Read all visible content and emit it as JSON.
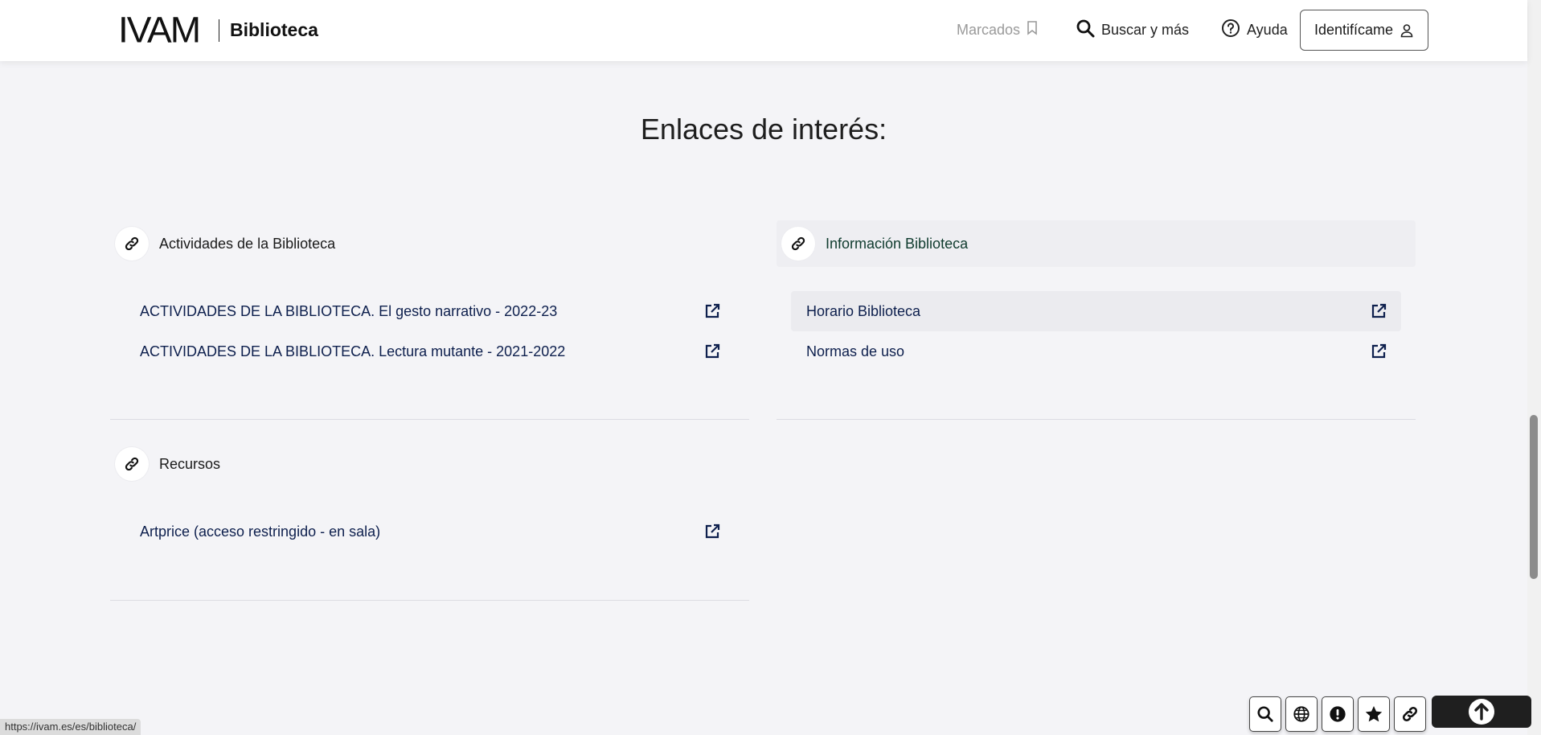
{
  "header": {
    "logo": "IVAM",
    "site_name": "Biblioteca",
    "marcados": "Marcados",
    "buscar": "Buscar y más",
    "ayuda": "Ayuda",
    "login": "Identifícame"
  },
  "main": {
    "title": "Enlaces de interés:",
    "cards": [
      {
        "title": "Actividades de la Biblioteca",
        "links": [
          "ACTIVIDADES DE LA BIBLIOTECA. El gesto narrativo - 2022-23",
          "ACTIVIDADES DE LA BIBLIOTECA. Lectura mutante - 2021-2022"
        ]
      },
      {
        "title": "Información Biblioteca",
        "links": [
          "Horario Biblioteca",
          "Normas de uso"
        ]
      },
      {
        "title": "Recursos",
        "links": [
          "Artprice (acceso restringido - en sala)"
        ]
      }
    ]
  },
  "toolbar": {
    "icons": [
      "search-icon",
      "globe-icon",
      "alert-icon",
      "star-icon",
      "link-icon",
      "arrow-up-icon"
    ]
  },
  "status_bar": {
    "url": "https://ivam.es/es/biblioteca/"
  },
  "colors": {
    "link_text": "#0d1f4d",
    "background": "#f4f4f7",
    "header_bg": "#ffffff"
  }
}
